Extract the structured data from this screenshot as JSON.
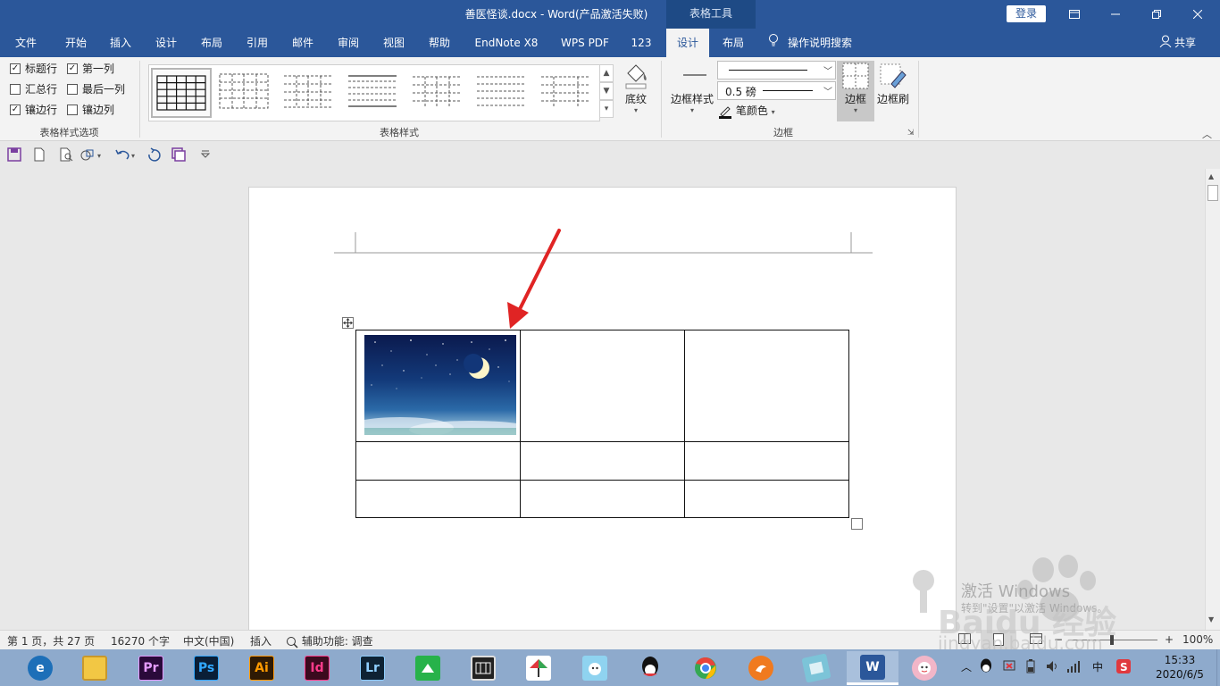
{
  "titlebar": {
    "title": "善医怪谈.docx  -  Word(产品激活失败)",
    "context_group": "表格工具",
    "login": "登录",
    "ribbon_display_icon": "ribbon-display-icon",
    "minimize_icon": "minimize-icon",
    "restore_icon": "restore-icon",
    "close_icon": "close-icon"
  },
  "tabs": [
    {
      "label": "文件"
    },
    {
      "label": "开始"
    },
    {
      "label": "插入"
    },
    {
      "label": "设计"
    },
    {
      "label": "布局"
    },
    {
      "label": "引用"
    },
    {
      "label": "邮件"
    },
    {
      "label": "审阅"
    },
    {
      "label": "视图"
    },
    {
      "label": "帮助"
    },
    {
      "label": "EndNote X8"
    },
    {
      "label": "WPS PDF"
    },
    {
      "label": "123"
    },
    {
      "label": "设计"
    },
    {
      "label": "布局"
    }
  ],
  "tell_me": "操作说明搜索",
  "share": "共享",
  "ribbon": {
    "style_options": {
      "group_label": "表格样式选项",
      "items": [
        {
          "label": "标题行",
          "checked": true
        },
        {
          "label": "第一列",
          "checked": true
        },
        {
          "label": "汇总行",
          "checked": false
        },
        {
          "label": "最后一列",
          "checked": false
        },
        {
          "label": "镶边行",
          "checked": true
        },
        {
          "label": "镶边列",
          "checked": false
        }
      ]
    },
    "table_styles": {
      "group_label": "表格样式",
      "shading_label": "底纹"
    },
    "borders": {
      "group_label": "边框",
      "border_styles_label": "边框样式",
      "weight_value": "0.5 磅",
      "pen_color_label": "笔颜色",
      "borders_label": "边框",
      "border_painter_label": "边框刷"
    }
  },
  "statusbar": {
    "page": "第 1 页，共 27 页",
    "words": "16270 个字",
    "language": "中文(中国)",
    "mode": "插入",
    "accessibility": "辅助功能: 调查",
    "zoom": "100%"
  },
  "watermark": {
    "line1": "激活 Windows",
    "line2": "转到\"设置\"以激活 Windows。",
    "brand": "Baidu 经验",
    "url": "jingyan.baidu.com"
  },
  "taskbar": {
    "apps": [
      {
        "name": "edge-icon",
        "label": "e",
        "color": "#1d6fb8"
      },
      {
        "name": "file-explorer-icon",
        "label": "",
        "color": "#f2c744"
      },
      {
        "name": "premiere-icon",
        "label": "Pr",
        "color": "#2a0a3a"
      },
      {
        "name": "photoshop-icon",
        "label": "Ps",
        "color": "#0a1e36"
      },
      {
        "name": "illustrator-icon",
        "label": "Ai",
        "color": "#2e1a05"
      },
      {
        "name": "indesign-icon",
        "label": "Id",
        "color": "#3b0a1e"
      },
      {
        "name": "lightroom-icon",
        "label": "Lr",
        "color": "#0e2233"
      },
      {
        "name": "green-app-icon",
        "label": "",
        "color": "#27b24a"
      },
      {
        "name": "video-editor-icon",
        "label": "",
        "color": "#222222"
      },
      {
        "name": "umbrella-app-icon",
        "label": "",
        "color": "#e8e8e8"
      },
      {
        "name": "bird-app-icon",
        "label": "",
        "color": "#8fd3f0"
      },
      {
        "name": "qq-icon",
        "label": "",
        "color": "#111111"
      },
      {
        "name": "chrome-icon",
        "label": "",
        "color": "#e9433a"
      },
      {
        "name": "orange-app-icon",
        "label": "",
        "color": "#f07a1f"
      },
      {
        "name": "notes-app-icon",
        "label": "",
        "color": "#7cc4d8"
      },
      {
        "name": "word-icon",
        "label": "W",
        "color": "#2b579a"
      },
      {
        "name": "mascot-app-icon",
        "label": "",
        "color": "#f2b6c8"
      }
    ],
    "ime": "中",
    "time": "15:33",
    "date": "2020/6/5"
  },
  "colors": {
    "word_blue": "#2b579a",
    "arrow_red": "#e02424"
  }
}
